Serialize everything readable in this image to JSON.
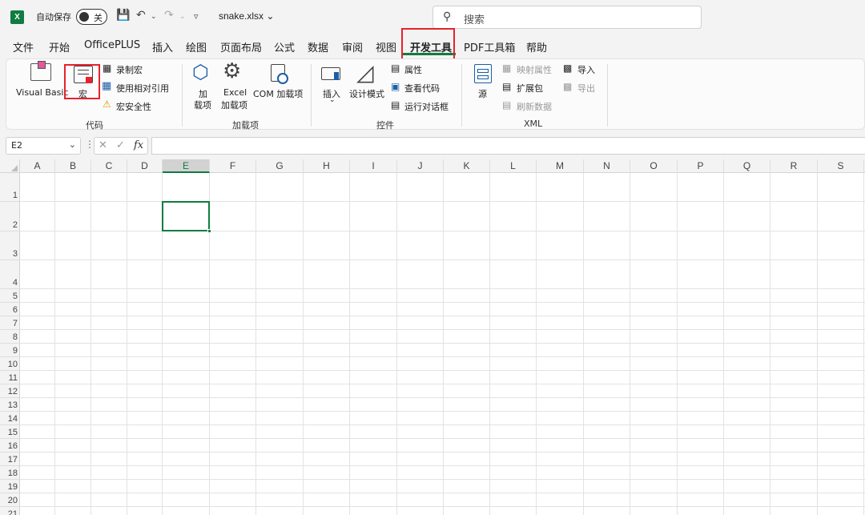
{
  "titlebar": {
    "app_icon": "excel-icon",
    "autosave_label": "自动保存",
    "autosave_state": "关",
    "filename": "snake.xlsx",
    "search_placeholder": "搜索"
  },
  "tabs": [
    "文件",
    "开始",
    "OfficePLUS",
    "插入",
    "绘图",
    "页面布局",
    "公式",
    "数据",
    "审阅",
    "视图",
    "开发工具",
    "PDF工具箱",
    "帮助"
  ],
  "active_tab": "开发工具",
  "ribbon": {
    "code": {
      "label": "代码",
      "visual_basic": "Visual Basic",
      "macros": "宏",
      "record_macro": "录制宏",
      "relative_ref": "使用相对引用",
      "macro_security": "宏安全性"
    },
    "addins": {
      "label": "加载项",
      "addins_line1": "加",
      "addins_line2": "载项",
      "excel_line1": "Excel",
      "excel_line2": "加载项",
      "com": "COM 加载项"
    },
    "controls": {
      "label": "控件",
      "insert": "插入",
      "design_mode": "设计模式",
      "properties": "属性",
      "view_code": "查看代码",
      "run_dialog": "运行对话框"
    },
    "xml": {
      "label": "XML",
      "source": "源",
      "map_properties": "映射属性",
      "expansion_packs": "扩展包",
      "refresh_data": "刷新数据",
      "import": "导入",
      "export": "导出"
    }
  },
  "formula_bar": {
    "name_box": "E2",
    "fx": "fx",
    "content": ""
  },
  "sheet": {
    "columns": [
      "A",
      "B",
      "C",
      "D",
      "E",
      "F",
      "G",
      "H",
      "I",
      "J",
      "K",
      "L",
      "M",
      "N",
      "O",
      "P",
      "Q",
      "R",
      "S"
    ],
    "rows": [
      "1",
      "2",
      "3",
      "4",
      "5",
      "6",
      "7",
      "8",
      "9",
      "10",
      "11",
      "12",
      "13",
      "14",
      "15",
      "16",
      "17",
      "18",
      "19",
      "20",
      "21"
    ],
    "selected_cell": "E2"
  },
  "colors": {
    "accent": "#107c41",
    "highlight": "#e8212b"
  }
}
